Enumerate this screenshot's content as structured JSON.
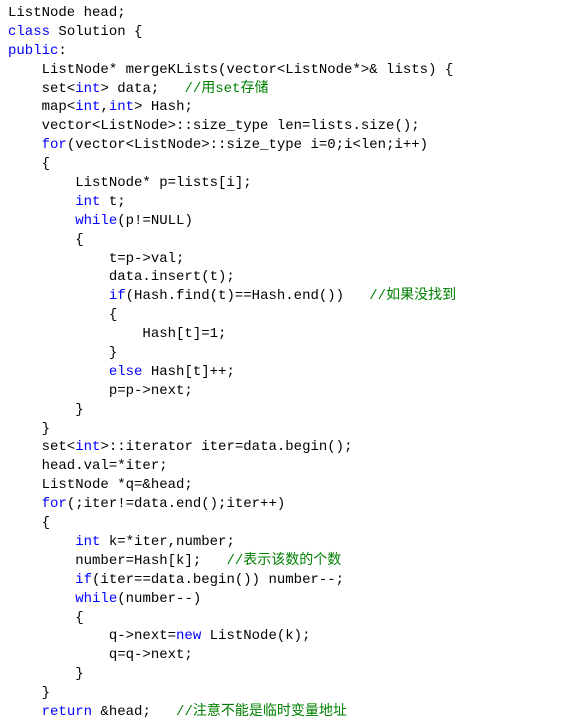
{
  "code": {
    "l01_a": "ListNode head;",
    "l02_a": "class",
    "l02_b": " Solution {",
    "l03_a": "public",
    "l03_b": ":",
    "l04_a": "    ListNode* mergeKLists(vector<ListNode*>& lists) {",
    "l05_a": "    set<",
    "l05_b": "int",
    "l05_c": "> data;   ",
    "l05_d": "//用set存储",
    "l06_a": "    map<",
    "l06_b": "int",
    "l06_c": ",",
    "l06_d": "int",
    "l06_e": "> Hash;",
    "l07_a": "    vector<ListNode>::size_type len=lists.size();",
    "l08_a": "    ",
    "l08_b": "for",
    "l08_c": "(vector<ListNode>::size_type i=0;i<len;i++)",
    "l09_a": "    {",
    "l10_a": "        ListNode* p=lists[i];",
    "l11_a": "        ",
    "l11_b": "int",
    "l11_c": " t;",
    "l12_a": "        ",
    "l12_b": "while",
    "l12_c": "(p!=NULL)",
    "l13_a": "        {",
    "l14_a": "            t=p->val;",
    "l15_a": "            data.insert(t);",
    "l16_a": "            ",
    "l16_b": "if",
    "l16_c": "(Hash.find(t)==Hash.end())   ",
    "l16_d": "//如果没找到",
    "l17_a": "            {",
    "l18_a": "                Hash[t]=1;",
    "l19_a": "            }",
    "l20_a": "            ",
    "l20_b": "else",
    "l20_c": " Hash[t]++;",
    "l21_a": "            p=p->next;",
    "l22_a": "        }",
    "l23_a": "    }",
    "l24_a": "    set<",
    "l24_b": "int",
    "l24_c": ">::iterator iter=data.begin();",
    "l25_a": "    head.val=*iter;",
    "l26_a": "    ListNode *q=&head;",
    "l27_a": "    ",
    "l27_b": "for",
    "l27_c": "(;iter!=data.end();iter++)",
    "l28_a": "    {",
    "l29_a": "        ",
    "l29_b": "int",
    "l29_c": " k=*iter,number;",
    "l30_a": "        number=Hash[k];   ",
    "l30_b": "//表示该数的个数",
    "l31_a": "        ",
    "l31_b": "if",
    "l31_c": "(iter==data.begin()) number--;",
    "l32_a": "        ",
    "l32_b": "while",
    "l32_c": "(number--)",
    "l33_a": "        {",
    "l34_a": "            q->next=",
    "l34_b": "new",
    "l34_c": " ListNode(k);",
    "l35_a": "            q=q->next;",
    "l36_a": "        }",
    "l37_a": "    }",
    "l38_a": "    ",
    "l38_b": "return",
    "l38_c": " &head;   ",
    "l38_d": "//注意不能是临时变量地址"
  }
}
